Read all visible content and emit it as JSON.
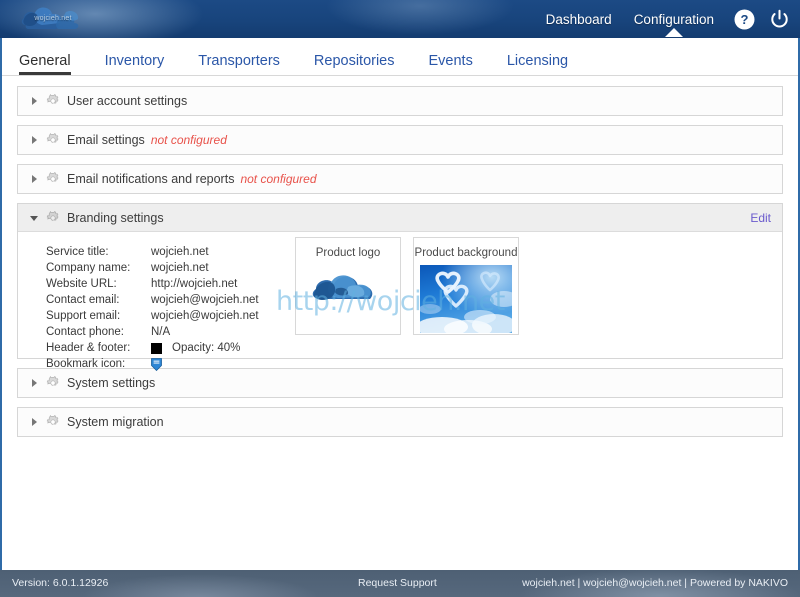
{
  "header": {
    "logo_text": "wojcieh.net",
    "logo_icon": "cloud-logo-icon",
    "nav": [
      {
        "label": "Dashboard",
        "active": false
      },
      {
        "label": "Configuration",
        "active": true
      }
    ],
    "help_icon": "help-circle-icon",
    "power_icon": "power-icon"
  },
  "tabs": [
    {
      "label": "General",
      "active": true
    },
    {
      "label": "Inventory",
      "active": false
    },
    {
      "label": "Transporters",
      "active": false
    },
    {
      "label": "Repositories",
      "active": false
    },
    {
      "label": "Events",
      "active": false
    },
    {
      "label": "Licensing",
      "active": false
    }
  ],
  "panels": [
    {
      "title": "User account settings",
      "note": "",
      "expanded": false
    },
    {
      "title": "Email settings",
      "note": "not configured",
      "expanded": false
    },
    {
      "title": "Email notifications and reports",
      "note": "not configured",
      "expanded": false
    },
    {
      "title": "Branding settings",
      "note": "",
      "expanded": true,
      "edit_label": "Edit"
    },
    {
      "title": "System settings",
      "note": "",
      "expanded": false
    },
    {
      "title": "System migration",
      "note": "",
      "expanded": false
    }
  ],
  "branding": {
    "fields": [
      {
        "label": "Service title:",
        "value": "wojcieh.net"
      },
      {
        "label": "Company name:",
        "value": "wojcieh.net"
      },
      {
        "label": "Website URL:",
        "value": "http://wojcieh.net"
      },
      {
        "label": "Contact email:",
        "value": "wojcieh@wojcieh.net"
      },
      {
        "label": "Support email:",
        "value": "wojcieh@wojcieh.net"
      },
      {
        "label": "Contact phone:",
        "value": "N/A"
      }
    ],
    "header_footer": {
      "label": "Header & footer:",
      "color": "#000000",
      "opacity_text": "Opacity: 40%"
    },
    "bookmark": {
      "label": "Bookmark icon:",
      "icon": "bookmark-shield-icon"
    },
    "thumbnails": [
      {
        "caption": "Product logo",
        "art": "cloud-logo-art"
      },
      {
        "caption": "Product background",
        "art": "sky-hearts-art"
      }
    ],
    "watermark": "http://wojcieh.net"
  },
  "footer": {
    "version": "Version: 6.0.1.12926",
    "support_link": "Request Support",
    "credits": "wojcieh.net | wojcieh@wojcieh.net | Powered by NAKIVO"
  },
  "colors": {
    "header_blue": "#1c4a85",
    "tab_link": "#2b57a8",
    "warning_red": "#e8524a",
    "edit_link": "#6a5acd",
    "watermark_blue": "#60b0e0"
  }
}
